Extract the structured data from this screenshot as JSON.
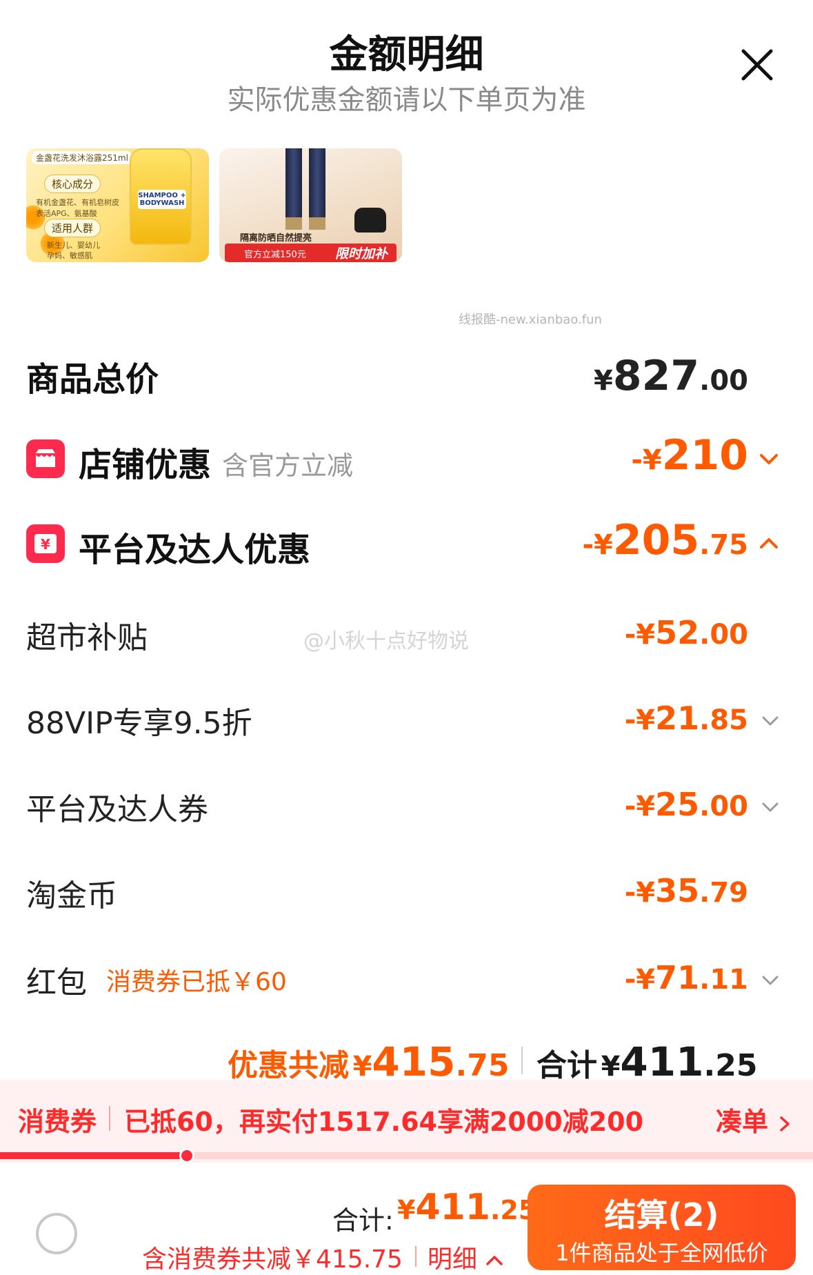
{
  "header": {
    "title": "金额明细",
    "subtitle": "实际优惠金额请以下单页为准"
  },
  "thumbnails": [
    {
      "label": "金盏花洗发沐浴露251ml",
      "pills": [
        "核心成分",
        "适用人群"
      ],
      "lines": [
        "有机金盏花、有机皂树皮",
        "表活APG、氨基酸",
        "新生儿、婴幼儿",
        "孕妈、敏感肌"
      ],
      "bottle_text": "SHAMPOO + BODYWASH"
    },
    {
      "caption": "隔离防晒自然提亮",
      "banner_left": "官方立减150元",
      "banner_right": "限时加补"
    }
  ],
  "watermarks": {
    "site": "线报酷-new.xianbao.fun",
    "weibo": "@小秋十点好物说"
  },
  "total_price": {
    "label": "商品总价",
    "currency": "¥",
    "int": "827",
    "dec": ".00"
  },
  "store_discount": {
    "label": "店铺优惠",
    "note": "含官方立减",
    "prefix": "-¥",
    "int": "210",
    "dec": ""
  },
  "platform_discount": {
    "label": "平台及达人优惠",
    "prefix": "-¥",
    "int": "205",
    "dec": ".75"
  },
  "breakdown": [
    {
      "label": "超市补贴",
      "prefix": "-¥",
      "int": "52",
      "dec": ".00",
      "expandable": false
    },
    {
      "label": "88VIP专享9.5折",
      "prefix": "-¥",
      "int": "21",
      "dec": ".85",
      "expandable": true
    },
    {
      "label": "平台及达人券",
      "prefix": "-¥",
      "int": "25",
      "dec": ".00",
      "expandable": true
    },
    {
      "label": "淘金币",
      "prefix": "-¥",
      "int": "35",
      "dec": ".79",
      "expandable": false
    },
    {
      "label": "红包",
      "note": "消费券已抵￥60",
      "prefix": "-¥",
      "int": "71",
      "dec": ".11",
      "expandable": true
    }
  ],
  "summary": {
    "discount_label": "优惠共减",
    "discount_prefix": "¥",
    "discount_int": "415",
    "discount_dec": ".75",
    "total_label": "合计",
    "total_prefix": "¥",
    "total_int": "411",
    "total_dec": ".25"
  },
  "coupon_bar": {
    "tag": "消费券",
    "text": "已抵60，再实付1517.64享满2000减200",
    "link": "凑单",
    "progress": 0.23
  },
  "footer": {
    "total_label": "合计:",
    "total_prefix": "¥",
    "total_int": "411",
    "total_dec": ".25",
    "note": "含消费券共减￥415.75",
    "detail": "明细",
    "checkout_label": "结算(2)",
    "checkout_sub": "1件商品处于全网低价"
  },
  "colors": {
    "accent": "#ff5a00",
    "red": "#ff2a2a",
    "icon_red": "#ff2a4e",
    "coupon_bg": "#fff0f1"
  }
}
